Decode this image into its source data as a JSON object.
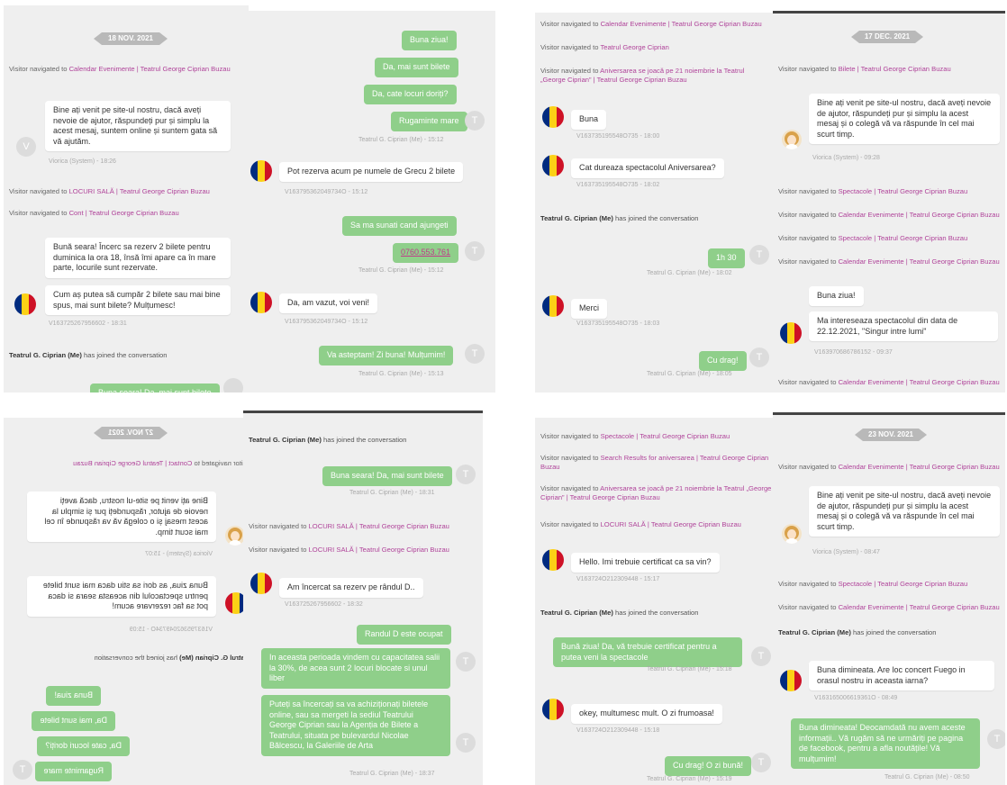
{
  "panels": {
    "p1a": {
      "date": "18 NOV. 2021",
      "nav_prefix": "Visitor navigated to",
      "nav1": "Calendar Evenimente | Teatrul George Ciprian Buzau",
      "welcome": "Bine ați venit pe site-ul nostru, dacă aveți nevoie de ajutor, răspundeți pur și simplu la acest mesaj, suntem online și suntem gata să vă ajutăm.",
      "welcome_meta": "Viorica (System) - 18:26",
      "avatar_letter": "V",
      "nav2": "LOCURI SALĂ | Teatrul George Ciprian Buzau",
      "nav3": "Cont | Teatrul George Ciprian Buzau",
      "msg1": "Bună seara! Încerc sa rezerv 2 bilete pentru duminica la ora 18, însă îmi apare ca în mare parte, locurile sunt rezervate.",
      "msg2": "Cum aș putea să cumpăr 2 bilete sau mai bine spus, mai sunt bilete? Mulțumesc!",
      "msg_meta": "V163725267956602 - 18:31",
      "join_name": "Teatrul G. Ciprian (Me)",
      "join_text": "has joined the conversation",
      "cut_bubble": "Buna seara! Da, mai sunt bilete"
    },
    "p1b": {
      "a1": "Buna ziua!",
      "a2": "Da, mai sunt bilete",
      "a3": "Da, cate locuri doriți?",
      "a4": "Rugaminte mare",
      "a_meta": "Teatrul G. Ciprian (Me) - 15:12",
      "v1": "Pot rezerva acum pe numele de Grecu 2 bilete",
      "v1_meta": "V163795362049734O - 15:12",
      "a5": "Sa ma sunati cand ajungeti",
      "phone": "0760.553.761",
      "a5_meta": "Teatrul G. Ciprian (Me) - 15:12",
      "v2": "Da, am vazut, voi veni!",
      "v2_meta": "V163795362049734O - 15:12",
      "a6": "Va asteptam! Zi buna! Mulțumim!",
      "a6_meta": "Teatrul G. Ciprian (Me) - 15:13",
      "tletter": "T"
    },
    "p2a": {
      "nav_prefix": "Visitor navigated to",
      "nav1": "Calendar Evenimente | Teatrul George Ciprian Buzau",
      "nav2": "Teatrul George Ciprian",
      "nav3": "Aniversarea se joacă pe 21 noiembrie la Teatrul „George Ciprian” | Teatrul George Ciprian Buzau",
      "v1": "Buna",
      "v1_meta": "V163735195548O735 - 18:00",
      "v2": "Cat dureaza spectacolul Aniversarea?",
      "v2_meta": "V163735195548O735 - 18:02",
      "join_name": "Teatrul G. Ciprian (Me)",
      "join_text": "has joined the conversation",
      "a1": "1h 30",
      "a1_meta": "Teatrul G. Ciprian (Me) - 18:02",
      "v3": "Merci",
      "v3_meta": "V163735195548O735 - 18:03",
      "a2": "Cu drag!",
      "a2_meta": "Teatrul G. Ciprian (Me) - 18:05",
      "tletter": "T"
    },
    "p2b": {
      "date": "17 DEC. 2021",
      "nav_prefix": "Visitor navigated to",
      "nav1": "Bilete | Teatrul George Ciprian Buzau",
      "welcome": "Bine ați venit pe site-ul nostru, dacă aveți nevoie de ajutor, răspundeți pur și simplu la acest mesaj și o colegă vă va răspunde în cel mai scurt timp.",
      "welcome_meta": "Viorica (System) - 09:28",
      "nav2": "Spectacole | Teatrul George Ciprian Buzau",
      "nav3": "Calendar Evenimente | Teatrul George Ciprian Buzau",
      "nav4": "Spectacole | Teatrul George Ciprian Buzau",
      "nav5": "Calendar Evenimente | Teatrul George Ciprian Buzau",
      "v1": "Buna ziua!",
      "v2": "Ma intereseaza spectacolul din data de 22.12.2021, \"Singur intre lumi\"",
      "v2_meta": "V163970686786152 - 09:37",
      "nav6": "Calendar Evenimente | Teatrul George Ciprian Buzau"
    },
    "p3a": {
      "date": "27 NOV. 2021",
      "nav_prefix": "Visitor navigated to",
      "nav1": "Contact | Teatrul George Ciprian Buzau",
      "welcome": "Bine ați venit pe site-ul nostru, dacă aveți nevoie de ajutor, răspundeți pur și simplu la acest mesaj și o colegă vă va răspunde în cel mai scurt timp.",
      "welcome_meta": "Viorica (System) - 15:07",
      "v1": "Buna ziua, as dori sa stiu daca mai sunt bilete pentru spectacolul din aceasta seara si daca pot sa fac rezervare acum!",
      "v1_meta": "V163795362049734O - 15:09",
      "join_name": "Teatrul G. Ciprian (Me)",
      "join_text": "has joined the conversation",
      "a1": "Buna ziua!",
      "a2": "Da, mai sunt bilete",
      "a3": "Da, cate locuri doriți?",
      "a4": "Rugaminte mare",
      "tletter": "T"
    },
    "p3b": {
      "join_name": "Teatrul G. Ciprian (Me)",
      "join_text": "has joined the conversation",
      "a1": "Buna seara! Da, mai sunt bilete",
      "a1_meta": "Teatrul G. Ciprian (Me) - 18:31",
      "nav_prefix": "Visitor navigated to",
      "nav1": "LOCURI SALĂ | Teatrul George Ciprian Buzau",
      "nav2": "LOCURI SALĂ | Teatrul George Ciprian Buzau",
      "v1": "Am încercat sa rezerv pe rândul D..",
      "v1_meta": "V163725267956602 - 18:32",
      "a2": "Randul D este ocupat",
      "a3": "In aceasta perioada vindem cu capacitatea salii la 30%, de acea sunt 2 locuri blocate si unul liber",
      "a4": "Puteți sa încercați sa va achiziționați biletele online, sau sa mergeti la sediul Teatrului George Ciprian sau la Agenția de Bilete a Teatrului, situata pe bulevardul Nicolae Bălcescu, la Galeriile de Arta",
      "a4_meta": "Teatrul G. Ciprian (Me) - 18:37",
      "tletter": "T"
    },
    "p4a": {
      "nav_prefix": "Visitor navigated to",
      "nav1": "Spectacole | Teatrul George Ciprian Buzau",
      "nav2": "Search Results for aniversarea | Teatrul George Ciprian Buzau",
      "nav3": "Aniversarea se joacă pe 21 noiembrie la Teatrul „George Ciprian” | Teatrul George Ciprian Buzau",
      "nav4": "LOCURI SALĂ | Teatrul George Ciprian Buzau",
      "v1": "Hello. Imi trebuie certificat ca sa vin?",
      "v1_meta": "V163724O212309448 - 15:17",
      "join_name": "Teatrul G. Ciprian (Me)",
      "join_text": "has joined the conversation",
      "a1": "Bună ziua! Da, vă trebuie certificat pentru a putea veni la spectacole",
      "a1_meta": "Teatrul G. Ciprian (Me) - 15:18",
      "v2": "okey, multumesc mult. O zi frumoasa!",
      "v2_meta": "V163724O212309448 - 15:18",
      "a2": "Cu drag! O zi bună!",
      "a2_meta": "Teatrul G. Ciprian (Me) - 15:19",
      "tletter": "T"
    },
    "p4b": {
      "date": "23 NOV. 2021",
      "nav_prefix": "Visitor navigated to",
      "nav1": "Calendar Evenimente | Teatrul George Ciprian Buzau",
      "welcome": "Bine ați venit pe site-ul nostru, dacă aveți nevoie de ajutor, răspundeți pur și simplu la acest mesaj și o colegă vă va răspunde în cel mai scurt timp.",
      "welcome_meta": "Viorica (System) - 08:47",
      "nav2": "Spectacole | Teatrul George Ciprian Buzau",
      "nav3": "Calendar Evenimente | Teatrul George Ciprian Buzau",
      "join_name": "Teatrul G. Ciprian (Me)",
      "join_text": "has joined the conversation",
      "v1": "Buna dimineata. Are loc concert Fuego in orasul nostru in aceasta iarna?",
      "v1_meta": "V163165006619361O - 08:49",
      "a1": "Buna dimineata! Deocamdată nu avem aceste informații.. Vă rugăm să ne urmăriți pe pagina de facebook, pentru a afla noutățile! Vă mulțumim!",
      "a1_meta": "Teatrul G. Ciprian (Me) - 08:50",
      "tletter": "T"
    }
  }
}
